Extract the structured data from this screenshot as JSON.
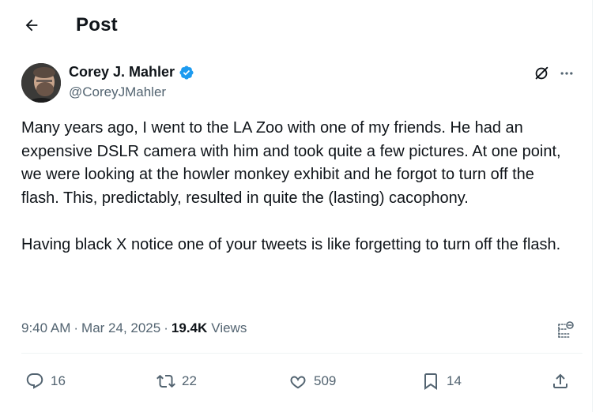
{
  "header": {
    "title": "Post"
  },
  "author": {
    "name": "Corey J. Mahler",
    "handle": "@CoreyJMahler",
    "verified": true
  },
  "tweet": {
    "text": "Many years ago, I went to the LA Zoo with one of my friends. He had an expensive DSLR camera with him and took quite a few pictures. At one point, we were looking at the howler monkey exhibit and he forgot to turn off the flash. This, predictably, resulted in quite the (lasting) cacophony.\n\nHaving black X notice one of your tweets is like forgetting to turn off the flash."
  },
  "meta": {
    "time": "9:40 AM",
    "date": "Mar 24, 2025",
    "views_count": "19.4K",
    "views_label": "Views"
  },
  "actions": {
    "replies": "16",
    "reposts": "22",
    "likes": "509",
    "bookmarks": "14"
  },
  "icons": {
    "back": "arrow-left-icon",
    "verified": "verified-badge-icon",
    "grok": "grok-icon",
    "more": "more-horizontal-icon",
    "analytics": "analytics-icon",
    "reply": "reply-icon",
    "repost": "repost-icon",
    "like": "heart-icon",
    "bookmark": "bookmark-icon",
    "share": "share-icon"
  },
  "colors": {
    "text": "#0f1419",
    "secondary": "#536471",
    "verified": "#1d9bf0",
    "border": "#eff3f4"
  }
}
